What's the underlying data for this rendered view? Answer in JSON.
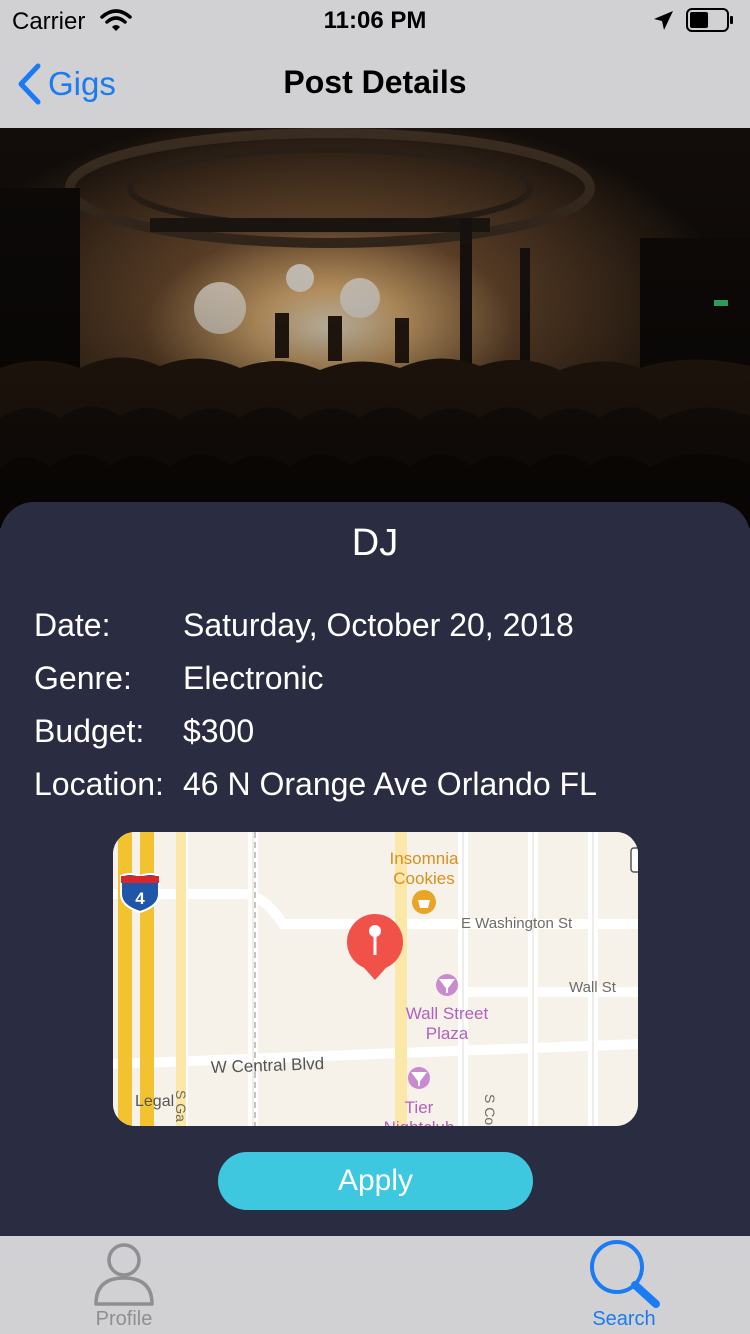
{
  "status_bar": {
    "carrier": "Carrier",
    "time": "11:06 PM"
  },
  "nav": {
    "back_label": "Gigs",
    "title": "Post Details"
  },
  "post": {
    "title": "DJ",
    "details": [
      {
        "label": "Date:",
        "value": "Saturday, October 20, 2018"
      },
      {
        "label": "Genre:",
        "value": "Electronic"
      },
      {
        "label": "Budget:",
        "value": "$300"
      },
      {
        "label": "Location:",
        "value": "46 N Orange Ave Orlando FL"
      }
    ]
  },
  "map": {
    "labels": {
      "insomnia_1": "Insomnia",
      "insomnia_2": "Cookies",
      "e_washington": "E Washington St",
      "wall_st": "Wall St",
      "wall_street_1": "Wall Street",
      "wall_street_2": "Plaza",
      "w_central": "W Central Blvd",
      "tier_1": "Tier",
      "tier_2": "Nightclub",
      "legal": "Legal",
      "interstate": "4",
      "s_garland": "S Ga",
      "s_court": "S Co"
    }
  },
  "apply_label": "Apply",
  "tabs": [
    {
      "label": "Profile",
      "active": false,
      "icon": "person-icon"
    },
    {
      "label": "Search",
      "active": true,
      "icon": "search-icon"
    }
  ],
  "colors": {
    "accent": "#1a7bf2",
    "card": "#2a2d42",
    "apply": "#3dc8e0",
    "pin": "#f0524a"
  }
}
